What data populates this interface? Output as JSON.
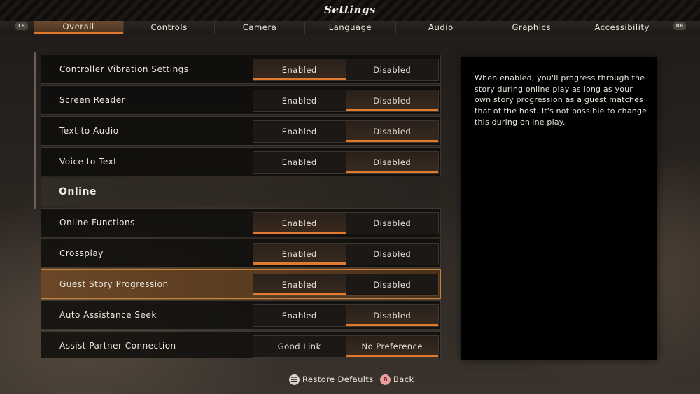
{
  "header": {
    "title": "Settings"
  },
  "tabbar": {
    "left_bumper": "LB",
    "right_bumper": "RB",
    "tabs": [
      {
        "label": "Overall",
        "active": true
      },
      {
        "label": "Controls"
      },
      {
        "label": "Camera"
      },
      {
        "label": "Language"
      },
      {
        "label": "Audio"
      },
      {
        "label": "Graphics"
      },
      {
        "label": "Accessibility"
      }
    ]
  },
  "rows": [
    {
      "label": "Controller Vibration Settings",
      "options": [
        "Enabled",
        "Disabled"
      ],
      "selected": "Enabled"
    },
    {
      "label": "Screen Reader",
      "options": [
        "Enabled",
        "Disabled"
      ],
      "selected": "Disabled"
    },
    {
      "label": "Text to Audio",
      "options": [
        "Enabled",
        "Disabled"
      ],
      "selected": "Disabled"
    },
    {
      "label": "Voice to Text",
      "options": [
        "Enabled",
        "Disabled"
      ],
      "selected": "Disabled"
    }
  ],
  "online_section": {
    "title": "Online"
  },
  "online_rows": [
    {
      "label": "Online Functions",
      "options": [
        "Enabled",
        "Disabled"
      ],
      "selected": "Enabled"
    },
    {
      "label": "Crossplay",
      "options": [
        "Enabled",
        "Disabled"
      ],
      "selected": "Enabled"
    },
    {
      "label": "Guest Story Progression",
      "options": [
        "Enabled",
        "Disabled"
      ],
      "selected": "Enabled",
      "focused": true
    },
    {
      "label": "Auto Assistance Seek",
      "options": [
        "Enabled",
        "Disabled"
      ],
      "selected": "Disabled"
    },
    {
      "label": "Assist Partner Connection",
      "options": [
        "Good Link",
        "No Preference"
      ],
      "selected": "No Preference"
    }
  ],
  "description": "When enabled, you'll progress through the story during online play as long as your own story progression as a guest matches that of the host. It's not possible to change this during online play.",
  "footer": {
    "restore_label": "Restore Defaults",
    "back_label": "Back",
    "back_glyph": "B"
  },
  "colors": {
    "accent": "#e07a2e",
    "selected_row": "#6b4726",
    "panel": "#000000"
  }
}
